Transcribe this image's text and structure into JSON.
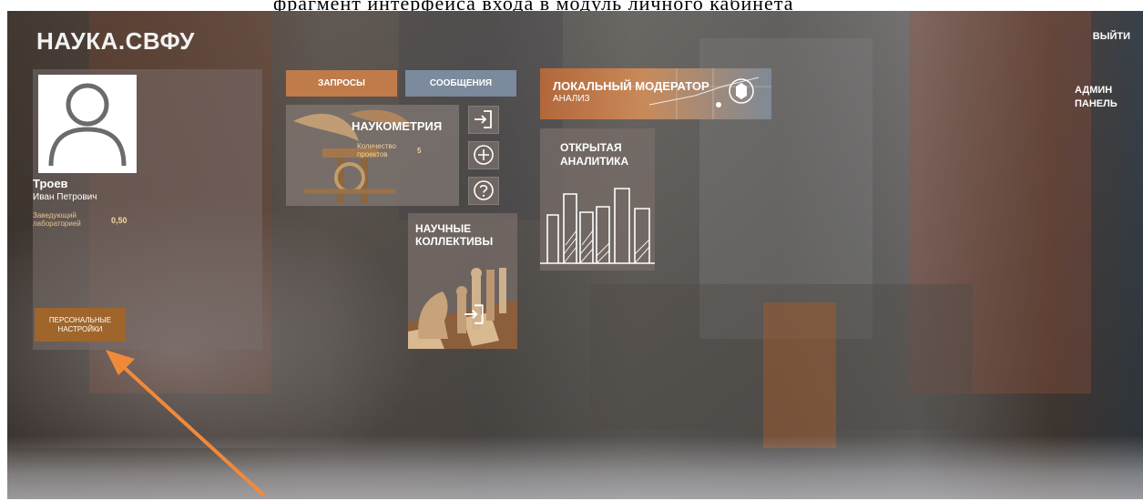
{
  "doc_strip": {
    "text": "фрагмент интерфейса входа в модуль личного кабинета"
  },
  "header": {
    "brand": "НАУКА.СВФУ",
    "logout_label": "ВЫЙТИ"
  },
  "admin": {
    "line1": "АДМИН",
    "line2": "ПАНЕЛЬ"
  },
  "profile": {
    "surname": "Троев",
    "given_names": "Иван Петрович",
    "position": "Заведующий лабораторией",
    "rate": "0,50",
    "settings_label": "ПЕРСОНАЛЬНЫЕ НАСТРОЙКИ"
  },
  "tabs": [
    {
      "label": "ЗАПРОСЫ",
      "color": "#c07b4a"
    },
    {
      "label": "СООБЩЕНИЯ",
      "color": "#7b8a9d"
    }
  ],
  "naukometriya": {
    "title": "НАУКОМЕТРИЯ",
    "projects_label": "Количество проектов",
    "projects_count": "5"
  },
  "collectives": {
    "title_line1": "НАУЧНЫЕ",
    "title_line2": "КОЛЛЕКТИВЫ"
  },
  "moderator": {
    "title": "ЛОКАЛЬНЫЙ МОДЕРАТОР",
    "subtitle": "АНАЛИЗ"
  },
  "analytics": {
    "title_line1": "ОТКРЫТАЯ",
    "title_line2": "АНАЛИТИКА"
  },
  "icons": {
    "enter": "enter-icon",
    "add": "add-circle-icon",
    "help": "help-circle-icon",
    "avatar": "user-avatar-icon"
  },
  "colors": {
    "accent": "#a0652a",
    "annotation_arrow": "#f08a3a"
  }
}
